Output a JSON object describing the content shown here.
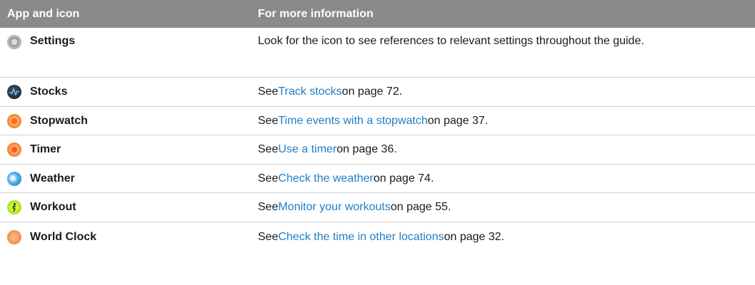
{
  "header": {
    "col1": "App and icon",
    "col2": "For more information"
  },
  "rows": [
    {
      "app": "Settings",
      "icon": "settings-icon",
      "prefix": "Look for the icon to see references to relevant settings throughout the guide.",
      "link": "",
      "suffix": ""
    },
    {
      "app": "Stocks",
      "icon": "stocks-icon",
      "prefix": "See ",
      "link": "Track stocks",
      "suffix": " on page 72."
    },
    {
      "app": "Stopwatch",
      "icon": "stopwatch-icon",
      "prefix": "See ",
      "link": "Time events with a stopwatch",
      "suffix": " on page 37."
    },
    {
      "app": "Timer",
      "icon": "timer-icon",
      "prefix": "See ",
      "link": "Use a timer",
      "suffix": " on page 36."
    },
    {
      "app": "Weather",
      "icon": "weather-icon",
      "prefix": "See ",
      "link": "Check the weather",
      "suffix": " on page 74."
    },
    {
      "app": "Workout",
      "icon": "workout-icon",
      "prefix": "See ",
      "link": "Monitor your workouts",
      "suffix": " on page 55."
    },
    {
      "app": "World Clock",
      "icon": "world-clock-icon",
      "prefix": "See ",
      "link": "Check the time in other locations",
      "suffix": " on page 32."
    }
  ],
  "colors": {
    "header_bg": "#8a8a8a",
    "link": "#1f7fc4",
    "divider": "#cfcfcf"
  }
}
